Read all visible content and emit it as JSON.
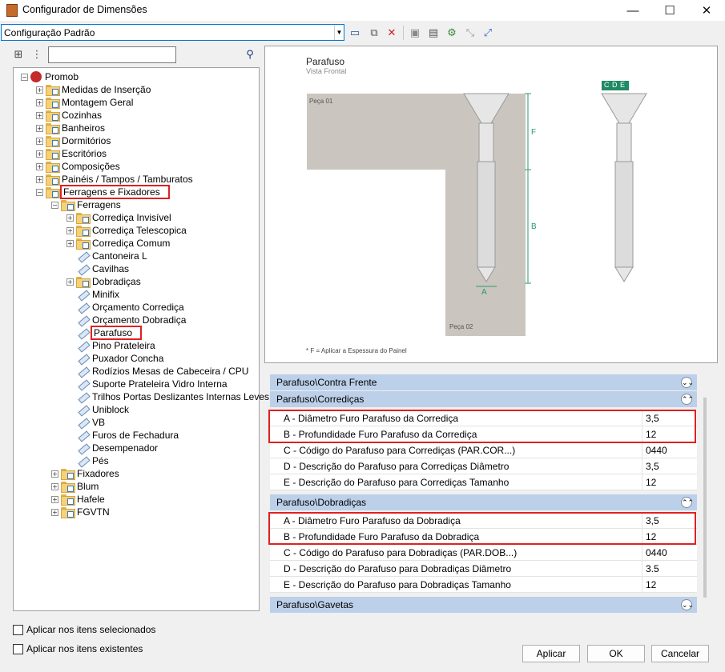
{
  "window": {
    "title": "Configurador de Dimensões"
  },
  "toolbar": {
    "config_value": "Configuração Padrão"
  },
  "tree": {
    "nodes": [
      {
        "label": "Promob",
        "level": 0,
        "type": "root",
        "expanded": true
      },
      {
        "label": "Medidas de Inserção",
        "level": 1,
        "type": "folder"
      },
      {
        "label": "Montagem Geral",
        "level": 1,
        "type": "folder"
      },
      {
        "label": "Cozinhas",
        "level": 1,
        "type": "folder"
      },
      {
        "label": "Banheiros",
        "level": 1,
        "type": "folder"
      },
      {
        "label": "Dormitórios",
        "level": 1,
        "type": "folder"
      },
      {
        "label": "Escritórios",
        "level": 1,
        "type": "folder"
      },
      {
        "label": "Composições",
        "level": 1,
        "type": "folder"
      },
      {
        "label": "Painéis / Tampos / Tamburatos",
        "level": 1,
        "type": "folder"
      },
      {
        "label": "Ferragens e Fixadores",
        "level": 1,
        "type": "folder",
        "expanded": true,
        "highlight": true
      },
      {
        "label": "Ferragens",
        "level": 2,
        "type": "folder",
        "expanded": true
      },
      {
        "label": "Corrediça Invisível",
        "level": 3,
        "type": "folder"
      },
      {
        "label": "Corrediça Telescopica",
        "level": 3,
        "type": "folder"
      },
      {
        "label": "Corrediça Comum",
        "level": 3,
        "type": "folder"
      },
      {
        "label": "Cantoneira L",
        "level": 3,
        "type": "leaf"
      },
      {
        "label": "Cavilhas",
        "level": 3,
        "type": "leaf"
      },
      {
        "label": "Dobradiças",
        "level": 3,
        "type": "folder"
      },
      {
        "label": "Minifix",
        "level": 3,
        "type": "leaf"
      },
      {
        "label": "Orçamento Corrediça",
        "level": 3,
        "type": "leaf"
      },
      {
        "label": "Orçamento Dobradiça",
        "level": 3,
        "type": "leaf"
      },
      {
        "label": "Parafuso",
        "level": 3,
        "type": "leaf",
        "highlight": true
      },
      {
        "label": "Pino Prateleira",
        "level": 3,
        "type": "leaf"
      },
      {
        "label": "Puxador Concha",
        "level": 3,
        "type": "leaf"
      },
      {
        "label": "Rodízios Mesas de Cabeceira / CPU",
        "level": 3,
        "type": "leaf"
      },
      {
        "label": "Suporte Prateleira Vidro Interna",
        "level": 3,
        "type": "leaf"
      },
      {
        "label": "Trilhos Portas Deslizantes Internas Leves",
        "level": 3,
        "type": "leaf"
      },
      {
        "label": "Uniblock",
        "level": 3,
        "type": "leaf"
      },
      {
        "label": "VB",
        "level": 3,
        "type": "leaf"
      },
      {
        "label": "Furos de Fechadura",
        "level": 3,
        "type": "leaf"
      },
      {
        "label": "Desempenador",
        "level": 3,
        "type": "leaf"
      },
      {
        "label": "Pés",
        "level": 3,
        "type": "leaf"
      },
      {
        "label": "Fixadores",
        "level": 2,
        "type": "folder"
      },
      {
        "label": "Blum",
        "level": 2,
        "type": "folder"
      },
      {
        "label": "Hafele",
        "level": 2,
        "type": "folder"
      },
      {
        "label": "FGVTN",
        "level": 2,
        "type": "folder"
      }
    ]
  },
  "preview": {
    "title": "Parafuso",
    "subtitle": "Vista Frontal",
    "part1": "Peça 01",
    "part2": "Peça 02",
    "dim_f": "F",
    "dim_b": "B",
    "dim_a": "A",
    "legend_c": "C",
    "legend_d": "D",
    "legend_e": "E",
    "footnote": "* F = Aplicar a Espessura do Painel"
  },
  "properties": {
    "group_contra": "Parafuso\\Contra Frente",
    "group_corredicas": "Parafuso\\Corrediças",
    "corredicas": [
      {
        "label": "A - Diâmetro Furo Parafuso da Corrediça",
        "value": "3,5"
      },
      {
        "label": "B - Profundidade Furo Parafuso da Corrediça",
        "value": "12"
      },
      {
        "label": "C - Código do Parafuso para Corrediças (PAR.COR...)",
        "value": "0440"
      },
      {
        "label": "D - Descrição do Parafuso para Corrediças Diâmetro",
        "value": "3,5"
      },
      {
        "label": "E - Descrição do Parafuso para Corrediças Tamanho",
        "value": "12"
      }
    ],
    "group_dobradicas": "Parafuso\\Dobradiças",
    "dobradicas": [
      {
        "label": "A - Diâmetro Furo Parafuso da Dobradiça",
        "value": "3,5"
      },
      {
        "label": "B - Profundidade Furo Parafuso da Dobradiça",
        "value": "12"
      },
      {
        "label": "C - Código do Parafuso para Dobradiças (PAR.DOB...)",
        "value": "0440"
      },
      {
        "label": "D - Descrição do Parafuso para Dobradiças Diâmetro",
        "value": "3.5"
      },
      {
        "label": "E - Descrição do Parafuso para Dobradiças Tamanho",
        "value": "12"
      }
    ],
    "group_gavetas": "Parafuso\\Gavetas"
  },
  "options": {
    "apply_selected": "Aplicar nos itens selecionados",
    "apply_existing": "Aplicar nos itens existentes"
  },
  "buttons": {
    "apply": "Aplicar",
    "ok": "OK",
    "cancel": "Cancelar"
  },
  "colors": {
    "accent": "#0078d7",
    "group_header": "#bcd0e9",
    "highlight": "#e02020",
    "dimension_line": "#2a9a6a"
  }
}
